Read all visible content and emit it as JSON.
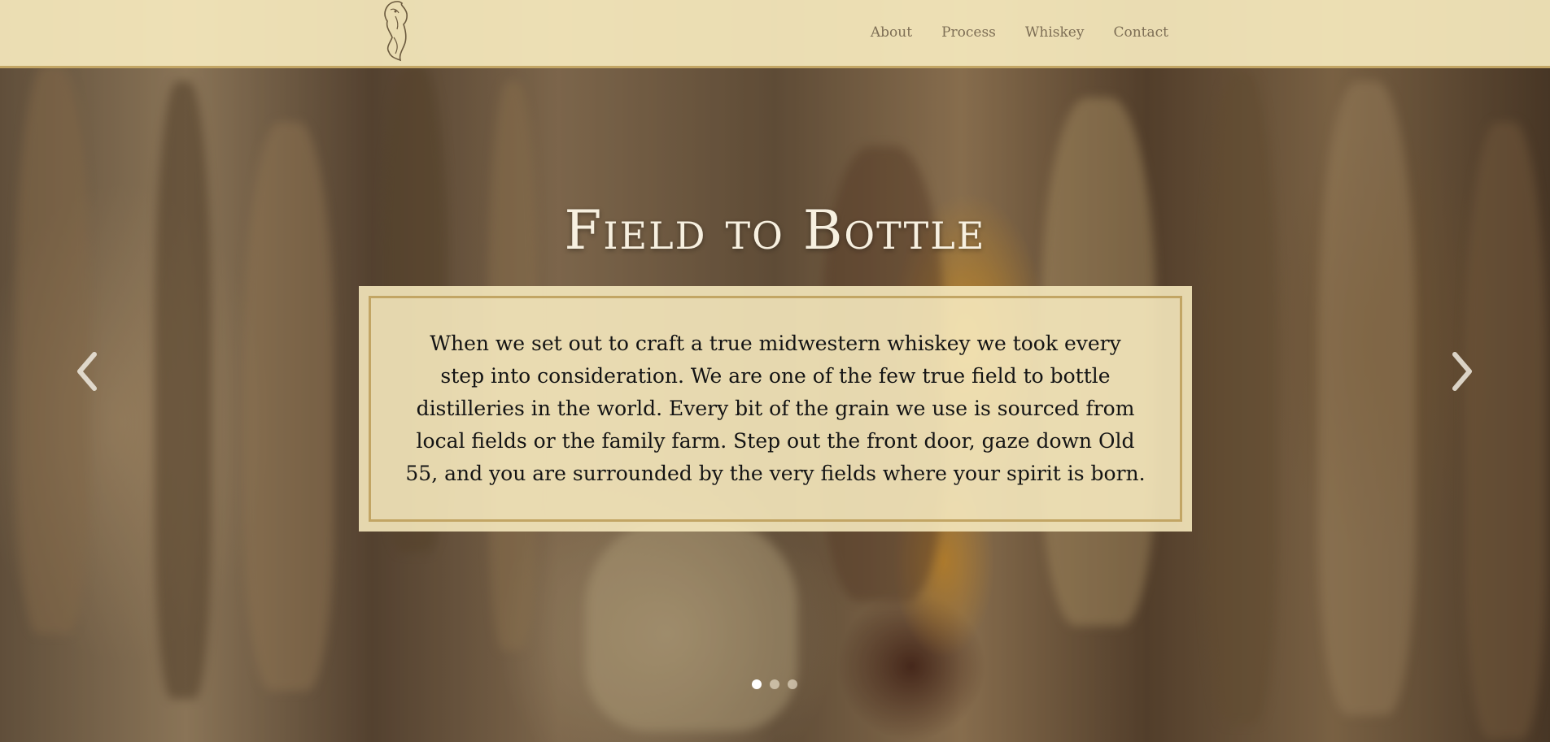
{
  "nav": {
    "logo_icon": "horse-head-logo",
    "links": [
      {
        "label": "About"
      },
      {
        "label": "Process"
      },
      {
        "label": "Whiskey"
      },
      {
        "label": "Contact"
      }
    ]
  },
  "hero": {
    "title": "Field to Bottle",
    "caption": "When we set out to craft a true midwestern whiskey we took every step into consideration. We are one of the few true field to bottle distilleries in the world. Every bit of the grain we use is sourced from local fields or the family farm. Step out the front door, gaze down Old 55, and you are surrounded by the very fields where your spirit is born.",
    "prev_icon": "chevron-left-icon",
    "next_icon": "chevron-right-icon",
    "slides_total": 3,
    "active_slide": 1
  },
  "colors": {
    "nav_background": "#f5e8bc",
    "accent_gold": "#c2a564",
    "nav_text": "#7d6e55",
    "title_text": "#f7f0e0"
  }
}
